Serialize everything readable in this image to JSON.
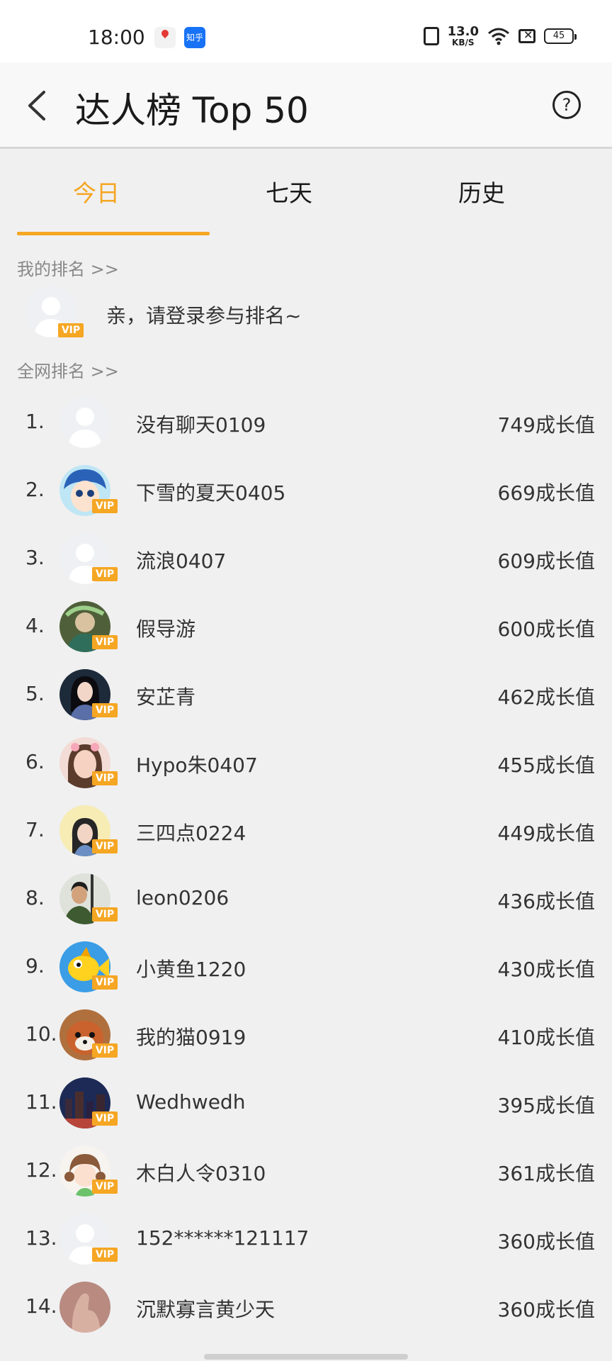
{
  "status_bar": {
    "time": "18:00",
    "app_icons": [
      "maps-icon",
      "zhihu-icon"
    ],
    "zhihu_label": "知乎",
    "net_speed_value": "13.0",
    "net_speed_unit": "KB/S",
    "battery": "45"
  },
  "header": {
    "title": "达人榜 Top 50",
    "back_icon": "chevron-left-icon",
    "help_icon": "question-circle-icon"
  },
  "tabs": [
    {
      "label": "今日",
      "active": true
    },
    {
      "label": "七天",
      "active": false
    },
    {
      "label": "历史",
      "active": false
    }
  ],
  "my_rank": {
    "section_label": "我的排名 >>",
    "prompt": "亲，请登录参与排名~",
    "vip_label": "VIP"
  },
  "global_rank": {
    "section_label": "全网排名 >>"
  },
  "rankings": [
    {
      "rank": "1.",
      "name": "没有聊天0109",
      "score": "749成长值",
      "vip": false,
      "avatar": "default"
    },
    {
      "rank": "2.",
      "name": "下雪的夏天0405",
      "score": "669成长值",
      "vip": true,
      "avatar": "anime"
    },
    {
      "rank": "3.",
      "name": "流浪0407",
      "score": "609成长值",
      "vip": true,
      "avatar": "default"
    },
    {
      "rank": "4.",
      "name": "假导游",
      "score": "600成长值",
      "vip": true,
      "avatar": "art"
    },
    {
      "rank": "5.",
      "name": "安芷青",
      "score": "462成长值",
      "vip": true,
      "avatar": "portrait-dark"
    },
    {
      "rank": "6.",
      "name": "Hypo朱0407",
      "score": "455成长值",
      "vip": true,
      "avatar": "portrait-light"
    },
    {
      "rank": "7.",
      "name": "三四点0224",
      "score": "449成长值",
      "vip": true,
      "avatar": "portrait-yellow"
    },
    {
      "rank": "8.",
      "name": "leon0206",
      "score": "436成长值",
      "vip": true,
      "avatar": "portrait-man"
    },
    {
      "rank": "9.",
      "name": "小黄鱼1220",
      "score": "430成长值",
      "vip": true,
      "avatar": "fish"
    },
    {
      "rank": "10.",
      "name": "我的猫0919",
      "score": "410成长值",
      "vip": true,
      "avatar": "red-panda"
    },
    {
      "rank": "11.",
      "name": "Wedhwedh",
      "score": "395成长值",
      "vip": true,
      "avatar": "city-night"
    },
    {
      "rank": "12.",
      "name": "木白人令0310",
      "score": "361成长值",
      "vip": true,
      "avatar": "cartoon-girl"
    },
    {
      "rank": "13.",
      "name": "152******121117",
      "score": "360成长值",
      "vip": true,
      "avatar": "default"
    },
    {
      "rank": "14.",
      "name": "沉默寡言黄少天",
      "score": "360成长值",
      "vip": false,
      "avatar": "hand"
    }
  ],
  "vip_label": "VIP",
  "colors": {
    "accent": "#f5a623",
    "background": "#f0f0f0"
  }
}
